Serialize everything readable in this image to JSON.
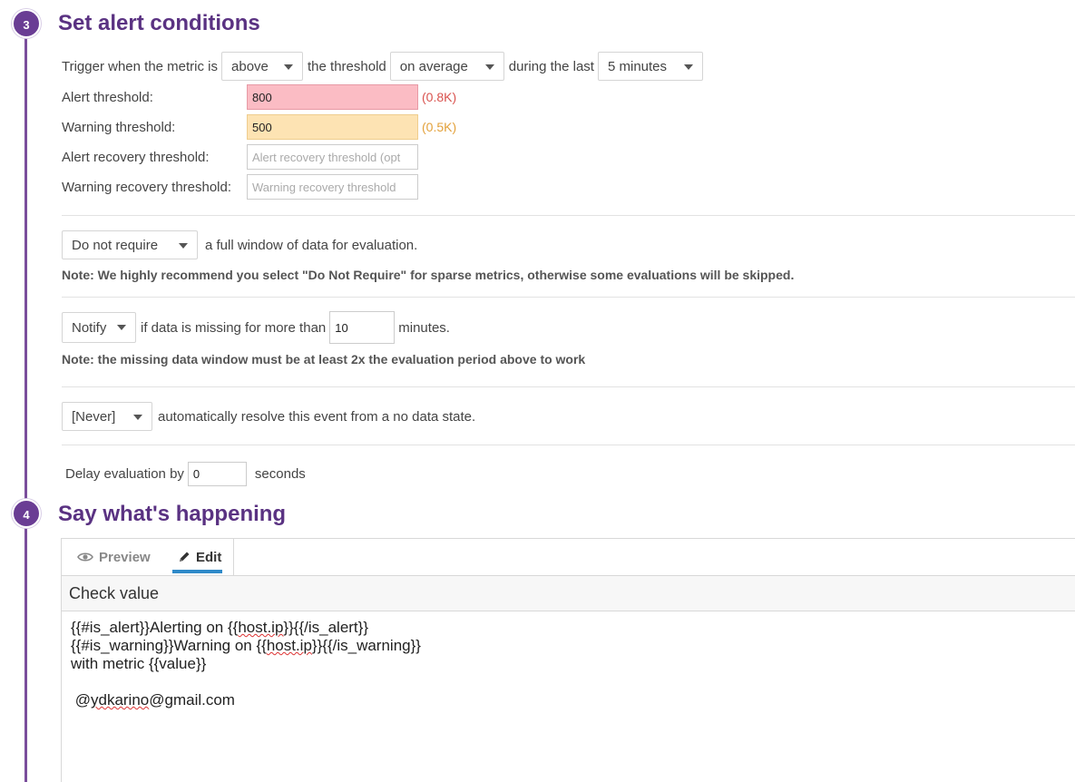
{
  "step3": {
    "number": "3",
    "title": "Set alert conditions",
    "trigger": {
      "prefix": "Trigger when the metric is",
      "comparison": "above",
      "middle": "the threshold",
      "aggregation": "on average",
      "during": "during the last",
      "window": "5 minutes"
    },
    "alert_threshold": {
      "label": "Alert threshold:",
      "value": "800",
      "hint": "(0.8K)"
    },
    "warning_threshold": {
      "label": "Warning threshold:",
      "value": "500",
      "hint": "(0.5K)"
    },
    "alert_recovery": {
      "label": "Alert recovery threshold:",
      "placeholder": "Alert recovery threshold (opt"
    },
    "warning_recovery": {
      "label": "Warning recovery threshold:",
      "placeholder": "Warning recovery threshold"
    },
    "full_window": {
      "value": "Do not require",
      "text": "a full window of data for evaluation."
    },
    "note1": "Note: We highly recommend you select \"Do Not Require\" for sparse metrics, otherwise some evaluations will be skipped.",
    "missing_data": {
      "value": "Notify",
      "text1": "if data is missing for more than",
      "minutes": "10",
      "text2": "minutes."
    },
    "note2": "Note: the missing data window must be at least 2x the evaluation period above to work",
    "resolve": {
      "value": "[Never]",
      "text": "automatically resolve this event from a no data state."
    },
    "delay": {
      "prefix": "Delay evaluation by",
      "value": "0",
      "suffix": "seconds"
    }
  },
  "step4": {
    "number": "4",
    "title": "Say what's happening",
    "tabs": {
      "preview": "Preview",
      "edit": "Edit"
    },
    "message_title": "Check value",
    "message_lines": {
      "l1a": "{{#is_alert}}Alerting on {{",
      "l1b": "host.ip",
      "l1c": "}}{{/is_alert}}",
      "l2a": "{{#is_warning}}Warning on {{",
      "l2b": "host.ip",
      "l2c": "}}{{/is_warning}}",
      "l3": "with metric {{value}}",
      "l4a": " @",
      "l4b": "ydkarino",
      "l4c": "@gmail.com"
    }
  },
  "colors": {
    "accent": "#6a3d94",
    "alert": "#fbbcc4",
    "warning": "#fde3b3",
    "tab_underline": "#2f8ac9"
  }
}
